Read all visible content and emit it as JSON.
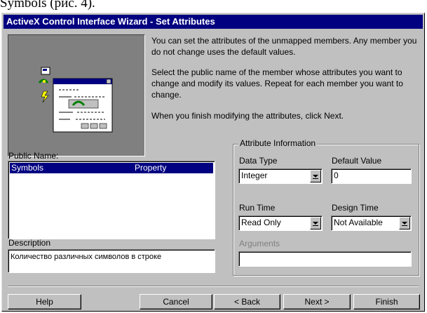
{
  "caption": "Symbols (рис. 4).",
  "window": {
    "title": "ActiveX Control Interface Wizard - Set Attributes"
  },
  "intro": {
    "p1": "You can set the attributes of the unmapped members.  Any member you do not change uses the default values.",
    "p2": "Select the public name of the member whose attributes you want to change and modify its values. Repeat for each member you want to change.",
    "p3": "When you finish modifying the attributes, click Next."
  },
  "public_name": {
    "label": "Public Name:",
    "items": [
      {
        "name": "Symbols",
        "type": "Property",
        "selected": true
      }
    ]
  },
  "description": {
    "label": "Description",
    "value": "Количество различных символов в строке"
  },
  "attributes": {
    "title": "Attribute Information",
    "data_type": {
      "label": "Data Type",
      "value": "Integer"
    },
    "default_value": {
      "label": "Default Value",
      "value": "0"
    },
    "run_time": {
      "label": "Run Time",
      "value": "Read Only"
    },
    "design_time": {
      "label": "Design Time",
      "value": "Not Available"
    },
    "arguments": {
      "label": "Arguments",
      "value": ""
    }
  },
  "buttons": {
    "help": "Help",
    "cancel": "Cancel",
    "back": "< Back",
    "next": "Next >",
    "finish": "Finish"
  },
  "colors": {
    "titlebar": "#000080",
    "face": "#c0c0c0",
    "selection": "#000080"
  },
  "icons": [
    "wizard-illustration-icon",
    "dropdown-arrow-icon"
  ]
}
